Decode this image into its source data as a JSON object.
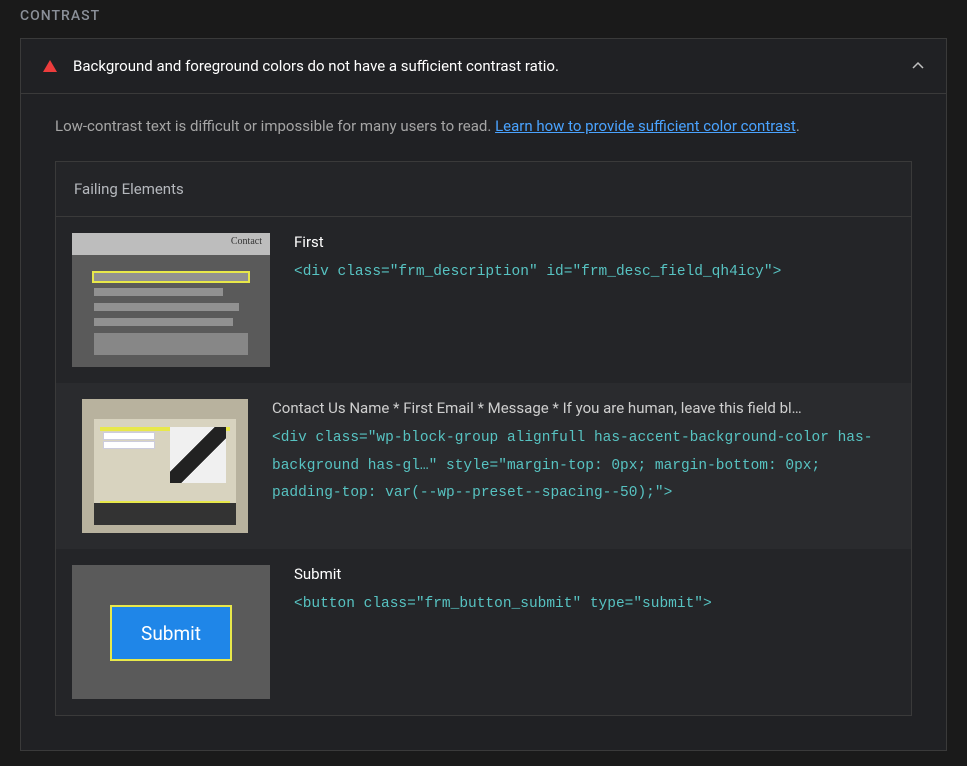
{
  "section_title": "CONTRAST",
  "audit": {
    "title": "Background and foreground colors do not have a sufficient contrast ratio.",
    "description_prefix": "Low-contrast text is difficult or impossible for many users to read. ",
    "description_link_text": "Learn how to provide sufficient color contrast",
    "description_suffix": "."
  },
  "failing_elements": {
    "header": "Failing Elements",
    "items": [
      {
        "title": "First",
        "code": "<div class=\"frm_description\" id=\"frm_desc_field_qh4icy\">",
        "thumb_hint": "Contact"
      },
      {
        "title": "Contact Us Name * First Email * Message * If you are human, leave this field bl…",
        "code": "<div class=\"wp-block-group alignfull has-accent-background-color has-background has-gl…\" style=\"margin-top: 0px; margin-bottom: 0px; padding-top: var(--wp--preset--spacing--50);\">"
      },
      {
        "title": "Submit",
        "code": "<button class=\"frm_button_submit\" type=\"submit\">",
        "thumb_button": "Submit"
      }
    ]
  }
}
